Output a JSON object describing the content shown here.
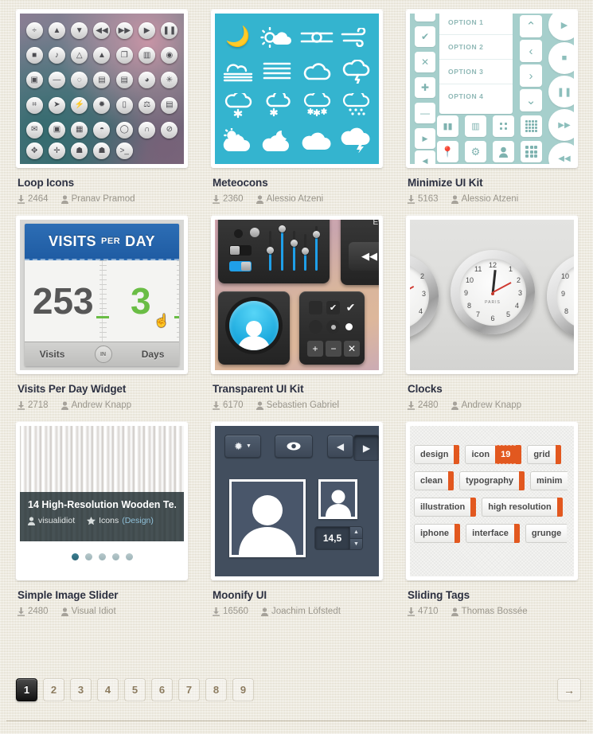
{
  "gallery": {
    "cards": [
      {
        "title": "Loop Icons",
        "downloads": "2464",
        "author": "Pranav Pramod",
        "thumb_type": "loop-icons"
      },
      {
        "title": "Meteocons",
        "downloads": "2360",
        "author": "Alessio Atzeni",
        "thumb_type": "meteocons"
      },
      {
        "title": "Minimize UI Kit",
        "downloads": "5163",
        "author": "Alessio Atzeni",
        "thumb_type": "minimize-ui-kit",
        "options": [
          "OPTION 1",
          "OPTION 2",
          "OPTION 3",
          "OPTION 4"
        ]
      },
      {
        "title": "Visits Per Day Widget",
        "downloads": "2718",
        "author": "Andrew Knapp",
        "thumb_type": "visits-per-day",
        "widget": {
          "header_1": "VISITS",
          "header_2": "PER",
          "header_3": "DAY",
          "visits_value": "253",
          "days_value": "3",
          "footer_left": "Visits",
          "footer_center": "IN",
          "footer_right": "Days"
        }
      },
      {
        "title": "Transparent UI Kit",
        "downloads": "6170",
        "author": "Sebastien Gabriel",
        "thumb_type": "transparent-ui-kit",
        "partial_label": "Every"
      },
      {
        "title": "Clocks",
        "downloads": "2480",
        "author": "Andrew Knapp",
        "thumb_type": "clocks",
        "clock_brand": "PARIS",
        "clock_numerals": [
          "12",
          "1",
          "2",
          "3",
          "4",
          "5",
          "6",
          "7",
          "8",
          "9",
          "10",
          "11"
        ]
      },
      {
        "title": "Simple Image Slider",
        "downloads": "2480",
        "author": "Visual Idiot",
        "thumb_type": "image-slider",
        "slide": {
          "headline": "14 High-Resolution Wooden Te...",
          "author": "visualidiot",
          "category": "Icons",
          "category_link": "(Design)",
          "dot_count": 5,
          "active_dot": 1
        }
      },
      {
        "title": "Moonify UI",
        "downloads": "16560",
        "author": "Joachim Löfstedt",
        "thumb_type": "moonify-ui",
        "spinner_value": "14,5"
      },
      {
        "title": "Sliding Tags",
        "downloads": "4710",
        "author": "Thomas Bossée",
        "thumb_type": "sliding-tags",
        "tags": [
          [
            {
              "label": "design"
            },
            {
              "label": "icon",
              "count": "19"
            },
            {
              "label": "grid"
            }
          ],
          [
            {
              "label": "clean"
            },
            {
              "label": "typography"
            },
            {
              "label": "minim"
            }
          ],
          [
            {
              "label": "illustration"
            },
            {
              "label": "high resolution"
            }
          ],
          [
            {
              "label": "iphone"
            },
            {
              "label": "interface"
            },
            {
              "label": "grunge"
            }
          ]
        ]
      }
    ]
  },
  "pagination": {
    "pages": [
      "1",
      "2",
      "3",
      "4",
      "5",
      "6",
      "7",
      "8",
      "9"
    ],
    "active_page": "1",
    "next_label": "→"
  },
  "colors": {
    "background": "#efece0",
    "title": "#2d3142",
    "meta": "#9a968c",
    "accent_orange": "#e2581f",
    "accent_blue": "#1f5ca3",
    "accent_green": "#6abd45",
    "teal": "#a6cfcc",
    "meteo_blue": "#34b4cf",
    "moonify_slate": "#424e5e"
  },
  "icons": {
    "download": "download-icon",
    "user": "user-icon",
    "star": "star-icon"
  }
}
